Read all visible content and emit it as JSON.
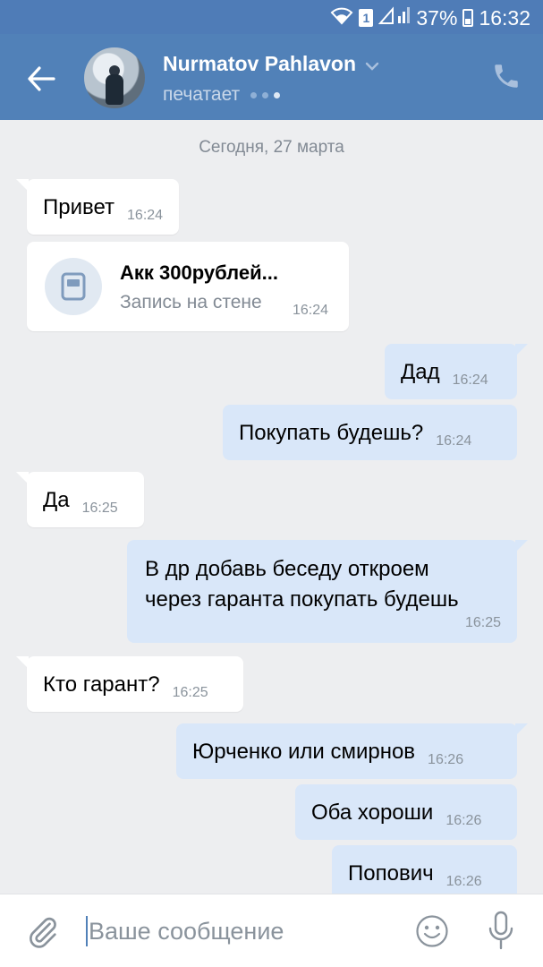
{
  "status_bar": {
    "sim": "1",
    "battery": "37%",
    "time": "16:32"
  },
  "header": {
    "name": "Nurmatov Pahlavon",
    "status": "печатает"
  },
  "chat": {
    "date": "Сегодня, 27 марта",
    "messages": [
      {
        "text": "Привет",
        "time": "16:24"
      },
      {
        "title": "Акк 300рублей...",
        "subtitle": "Запись на стене",
        "time": "16:24"
      },
      {
        "text": "Дад",
        "time": "16:24"
      },
      {
        "text": "Покупать будешь?",
        "time": "16:24"
      },
      {
        "text": "Да",
        "time": "16:25"
      },
      {
        "lines": [
          "В др добавь беседу откроем",
          "через гаранта покупать будешь"
        ],
        "time": "16:25"
      },
      {
        "text": "Кто гарант?",
        "time": "16:25"
      },
      {
        "text": "Юрченко или смирнов",
        "time": "16:26"
      },
      {
        "text": "Оба хороши",
        "time": "16:26"
      },
      {
        "text": "Попович",
        "time": "16:26"
      }
    ]
  },
  "composer": {
    "placeholder": "Ваше сообщение"
  }
}
